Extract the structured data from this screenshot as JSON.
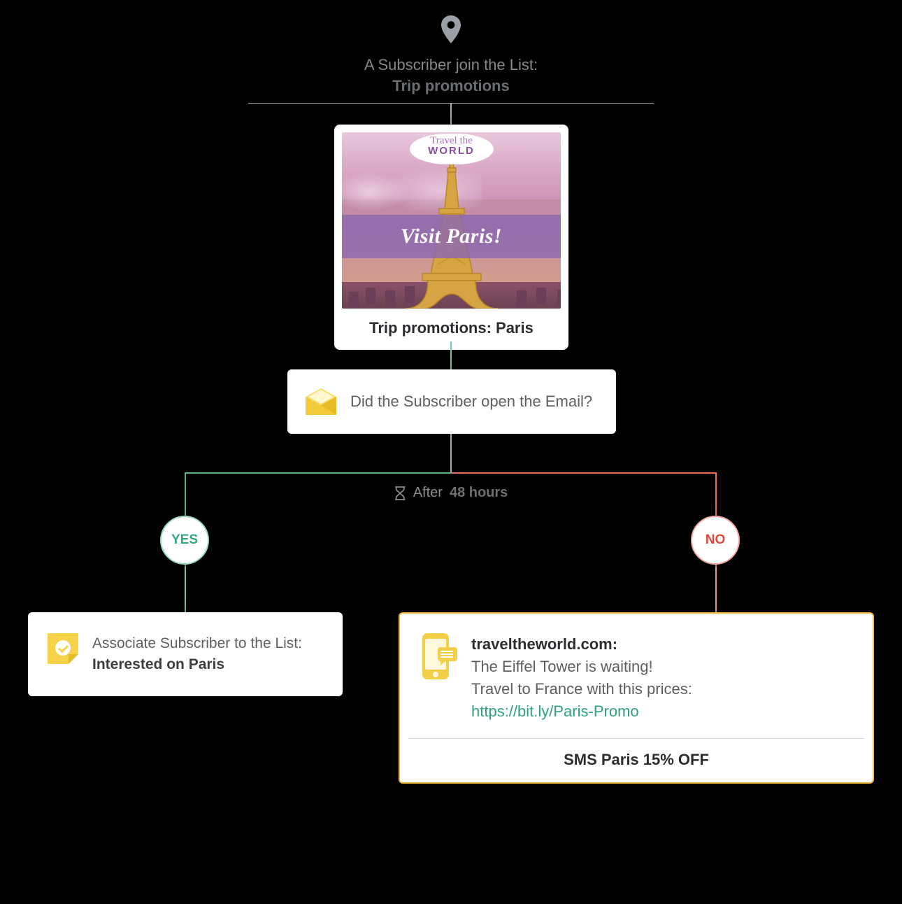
{
  "trigger": {
    "line1": "A Subscriber join the List:",
    "line2": "Trip promotions"
  },
  "email": {
    "badge_line1": "Travel the",
    "badge_line2": "WORLD",
    "banner_text": "Visit Paris!",
    "caption": "Trip promotions: Paris"
  },
  "condition": {
    "question": "Did the Subscriber open the Email?"
  },
  "delay": {
    "prefix": "After",
    "value": "48 hours"
  },
  "branches": {
    "yes_label": "YES",
    "no_label": "NO"
  },
  "yes_action": {
    "line1": "Associate Subscriber to the List:",
    "line2": "Interested on Paris"
  },
  "no_action": {
    "site": "traveltheworld.com:",
    "body_line1": "The Eiffel Tower is waiting!",
    "body_line2": "Travel to France with this prices:",
    "link": "https://bit.ly/Paris-Promo",
    "footer": "SMS Paris 15% OFF"
  }
}
